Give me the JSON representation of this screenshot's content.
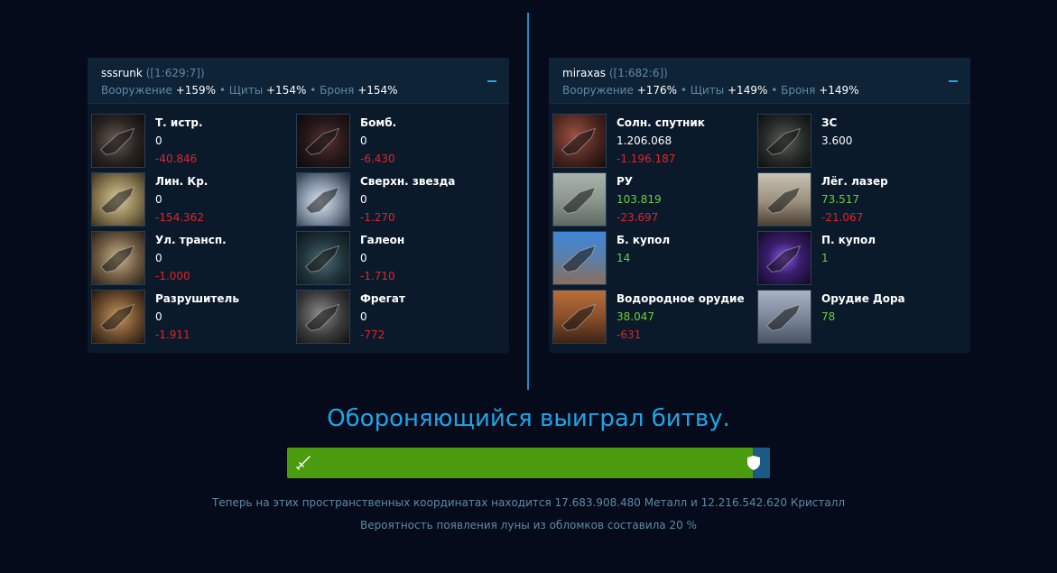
{
  "attacker": {
    "name": "sssrunk",
    "coords": "([1:629:7])",
    "stats": [
      {
        "label": "Вооружение",
        "value": "+159%"
      },
      {
        "label": "Щиты",
        "value": "+154%"
      },
      {
        "label": "Броня",
        "value": "+154%"
      }
    ],
    "units": [
      {
        "name": "Т. истр.",
        "count": "0",
        "loss": "-40.846",
        "icon": "heavy-fighter-icon"
      },
      {
        "name": "Бомб.",
        "count": "0",
        "loss": "-6.430",
        "icon": "bomber-icon"
      },
      {
        "name": "Лин. Кр.",
        "count": "0",
        "loss": "-154.362",
        "icon": "battlecruiser-icon"
      },
      {
        "name": "Сверхн. звезда",
        "count": "0",
        "loss": "-1.270",
        "icon": "supernova-icon"
      },
      {
        "name": "Ул. трансп.",
        "count": "0",
        "loss": "-1.000",
        "icon": "improved-transport-icon"
      },
      {
        "name": "Галеон",
        "count": "0",
        "loss": "-1.710",
        "icon": "galleon-icon"
      },
      {
        "name": "Разрушитель",
        "count": "0",
        "loss": "-1.911",
        "icon": "destroyer-icon"
      },
      {
        "name": "Фрегат",
        "count": "0",
        "loss": "-772",
        "icon": "frigate-icon"
      }
    ]
  },
  "defender": {
    "name": "miraxas",
    "coords": "([1:682:6])",
    "stats": [
      {
        "label": "Вооружение",
        "value": "+176%"
      },
      {
        "label": "Щиты",
        "value": "+149%"
      },
      {
        "label": "Броня",
        "value": "+149%"
      }
    ],
    "units": [
      {
        "name": "Солн. спутник",
        "count": "1.206.068",
        "loss": "-1.196.187",
        "icon": "solar-satellite-icon",
        "green": false
      },
      {
        "name": "ЗС",
        "count": "3.600",
        "loss": "",
        "icon": "death-star-icon",
        "green": false
      },
      {
        "name": "РУ",
        "count": "103.819",
        "loss": "-23.697",
        "icon": "rocket-launcher-icon",
        "green": true
      },
      {
        "name": "Лёг. лазер",
        "count": "73.517",
        "loss": "-21.067",
        "icon": "light-laser-icon",
        "green": true
      },
      {
        "name": "Б. купол",
        "count": "14",
        "loss": "",
        "icon": "large-dome-icon",
        "green": true
      },
      {
        "name": "П. купол",
        "count": "1",
        "loss": "",
        "icon": "planet-dome-icon",
        "green": true
      },
      {
        "name": "Водородное орудие",
        "count": "38.047",
        "loss": "-631",
        "icon": "hydrogen-cannon-icon",
        "green": true
      },
      {
        "name": "Орудие Дора",
        "count": "78",
        "loss": "",
        "icon": "dora-cannon-icon",
        "green": true
      }
    ]
  },
  "result_text": "Обороняющийся выиграл битву.",
  "battle_progress": 0.965,
  "debris_text": "Теперь на этих пространственных координатах находится 17.683.908.480 Металл и 12.216.542.620 Кристалл",
  "moon_text": "Вероятность появления луны из обломков составила 20 %",
  "colors": {
    "accent": "#1da5e6",
    "positive": "#6ccf34",
    "negative": "#e02424",
    "bar_fill": "#4a9b0e"
  }
}
